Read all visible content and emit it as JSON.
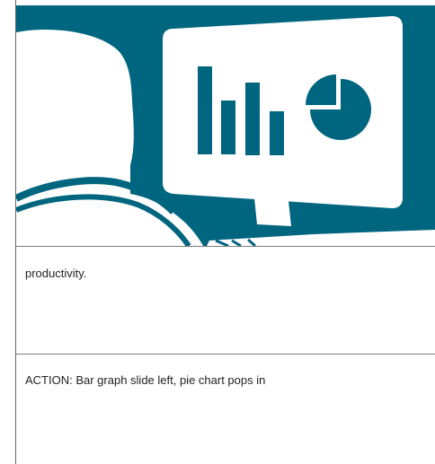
{
  "panel": {
    "illustration_icon": "person-viewing-monitor-with-bar-and-pie-chart",
    "accent_color": "#00657f",
    "monitor_color": "#ffffff"
  },
  "notes": {
    "narration_text": "productivity.",
    "action_text": "ACTION: Bar graph slide left, pie chart pops in"
  }
}
